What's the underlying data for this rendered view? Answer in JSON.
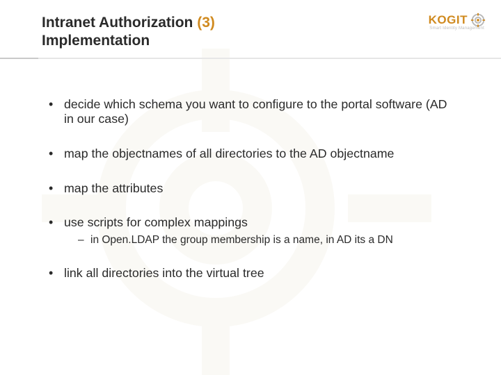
{
  "header": {
    "title_line1_pre": "Intranet Authorization ",
    "title_line1_accent": "(3)",
    "title_line2": "Implementation"
  },
  "logo": {
    "text": "KOGIT",
    "tagline": "Smart Identity Management"
  },
  "bullets": [
    {
      "text": "decide which schema you want to configure to the portal software (AD in our case)"
    },
    {
      "text": "map the objectnames of all directories to the AD objectname"
    },
    {
      "text": "map the attributes"
    },
    {
      "text": "use scripts for complex mappings",
      "sub": [
        "in Open.LDAP the group membership is a name, in AD its a DN"
      ]
    },
    {
      "text": "link all directories into the virtual tree"
    }
  ]
}
